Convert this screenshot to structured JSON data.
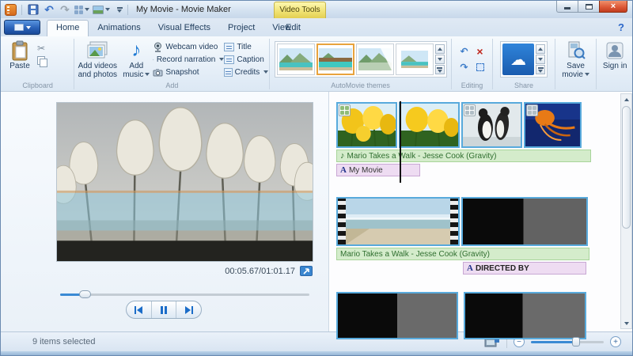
{
  "icons": {
    "close": "×",
    "help": "?",
    "undo": "↶",
    "redo": "↷",
    "rotate_left": "↶",
    "rotate_right": "↷",
    "remove": "×",
    "music_note": "♪",
    "cloud": "☁",
    "text_tool": "A",
    "minus": "−",
    "plus": "+",
    "cut": "✂"
  },
  "titlebar": {
    "title": "My Movie - Movie Maker",
    "contextual_tab": "Video Tools"
  },
  "tabs": {
    "home": "Home",
    "animations": "Animations",
    "visual_effects": "Visual Effects",
    "project": "Project",
    "view": "View",
    "edit": "Edit"
  },
  "ribbon": {
    "clipboard": {
      "paste": "Paste",
      "group_label": "Clipboard"
    },
    "add": {
      "add_videos": "Add videos and photos",
      "add_music": "Add music",
      "webcam": "Webcam video",
      "record_narration": "Record narration",
      "snapshot": "Snapshot",
      "title": "Title",
      "caption": "Caption",
      "credits": "Credits",
      "group_label": "Add"
    },
    "themes": {
      "group_label": "AutoMovie themes"
    },
    "editing": {
      "group_label": "Editing"
    },
    "share": {
      "group_label": "Share",
      "save_movie": "Save movie",
      "sign_in": "Sign in"
    }
  },
  "preview": {
    "timecode": "00:05.67/01:01.17"
  },
  "timeline": {
    "row1": {
      "music_text": "Mario Takes a Walk - Jesse Cook (Gravity)",
      "title_text": "My Movie"
    },
    "row2": {
      "music_text": "Mario Takes a Walk - Jesse Cook (Gravity)",
      "caption_text": "DIRECTED BY"
    }
  },
  "statusbar": {
    "selection": "9 items selected"
  },
  "colors": {
    "selection_border": "#58aadc",
    "music_track_bg": "#d4eccb",
    "text_track_bg": "#eedcf2",
    "contextual_tab_bg": "#f0e171",
    "onedrive_blue": "#2270c8"
  }
}
